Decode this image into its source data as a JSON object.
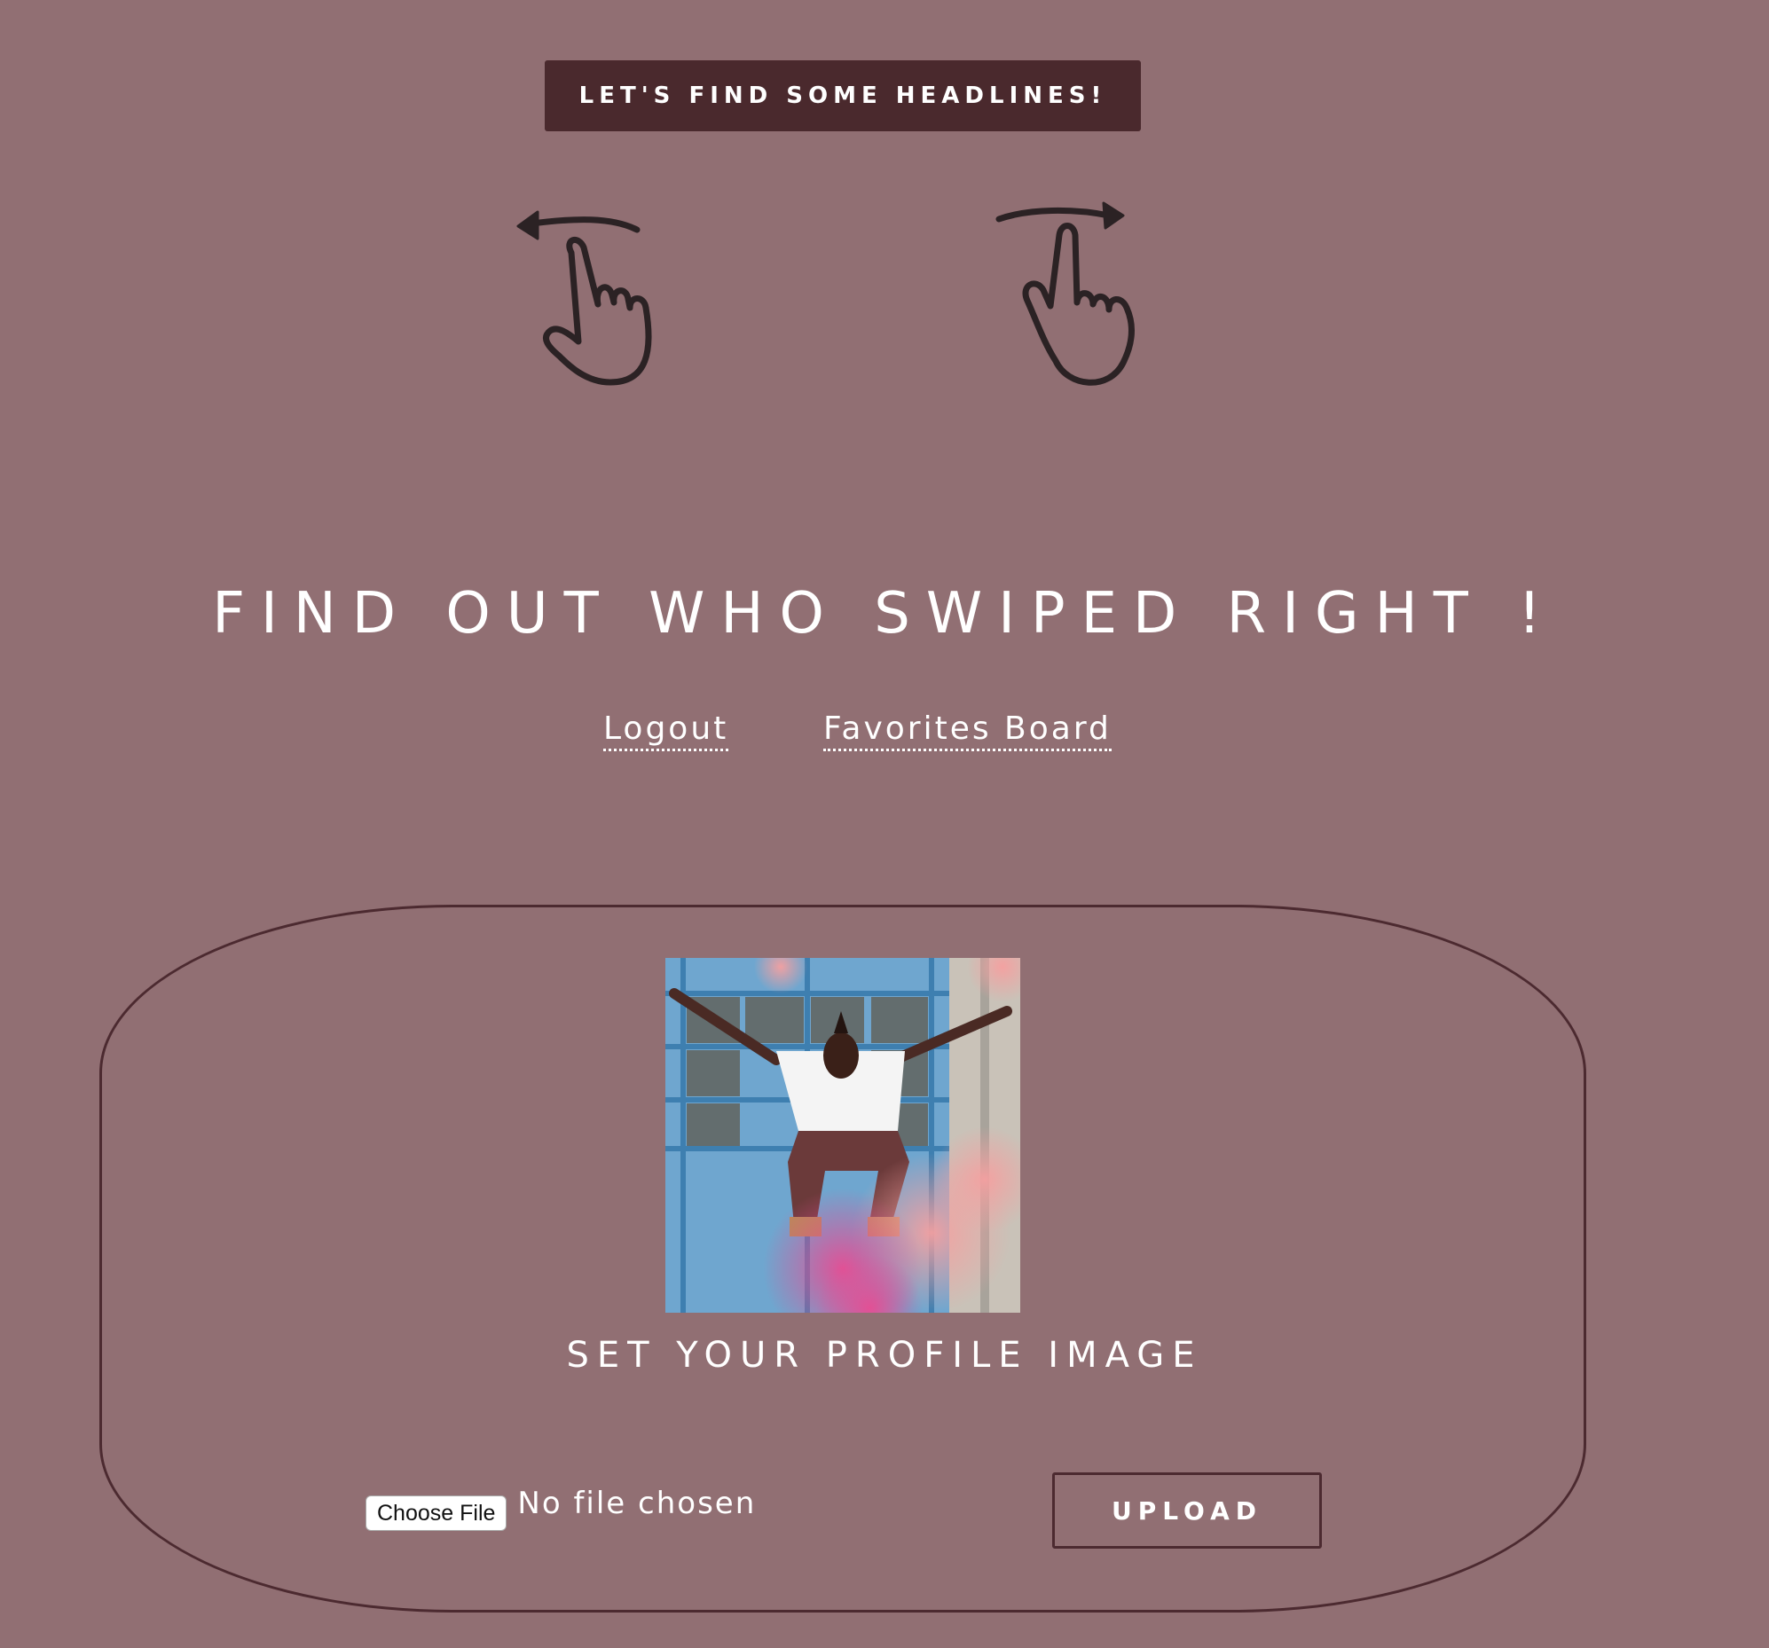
{
  "header": {
    "find_button_label": "LET'S FIND SOME HEADLINES!"
  },
  "swipe_icons": {
    "left": "swipe-left-hand-icon",
    "right": "swipe-right-hand-icon"
  },
  "main": {
    "headline": "FIND OUT WHO SWIPED RIGHT !",
    "nav": {
      "logout_label": "Logout",
      "favorites_label": "Favorites Board"
    }
  },
  "profile": {
    "image_alt": "profile photo of a person jumping with pink smoke",
    "set_label": "SET YOUR PROFILE IMAGE",
    "choose_file_label": "Choose File",
    "no_file_text": "No file chosen",
    "upload_label": "UPLOAD"
  },
  "colors": {
    "background": "#916f73",
    "button_dark": "#4a292d",
    "border": "#4c2a30",
    "text": "#ffffff"
  }
}
